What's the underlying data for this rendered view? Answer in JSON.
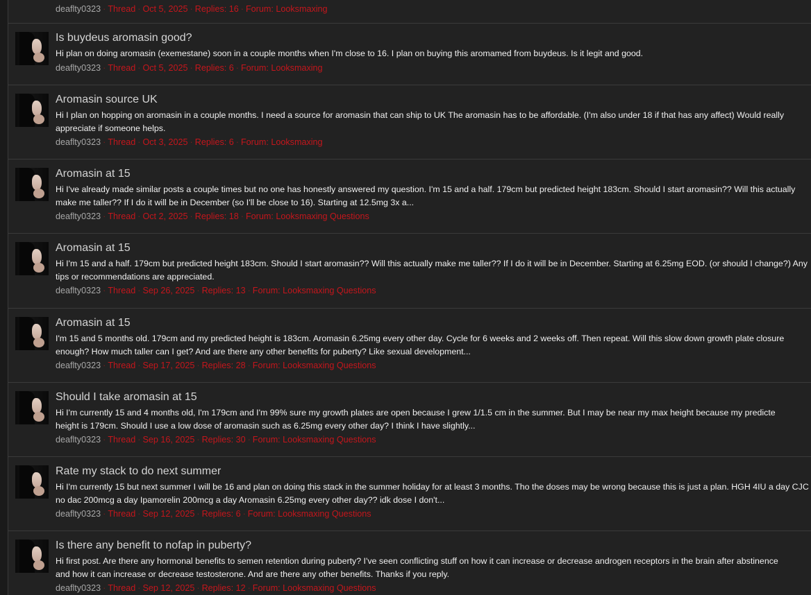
{
  "colors": {
    "background": "#222222",
    "accent_red": "#c4161c",
    "title": "#d4d4d4",
    "author": "#a8a8a8",
    "divider": "#3b3b3b"
  },
  "results": [
    {
      "title": "",
      "snippet": "",
      "author": "deaflty0323",
      "type": "Thread",
      "date": "Oct 5, 2025",
      "replies": "Replies: 16",
      "forum": "Forum: Looksmaxing"
    },
    {
      "title": "Is buydeus aromasin good?",
      "snippet": "Hi plan on doing aromasin (exemestane) soon in a couple months when I'm close to 16. I plan on buying this aromamed from buydeus. Is it legit and good.",
      "author": "deaflty0323",
      "type": "Thread",
      "date": "Oct 5, 2025",
      "replies": "Replies: 6",
      "forum": "Forum: Looksmaxing"
    },
    {
      "title": "Aromasin source UK",
      "snippet": "Hi I plan on hopping on aromasin in a couple months. I need a source for aromasin that can ship to UK The aromasin has to be affordable. (I'm also under 18 if that has any affect) Would really appreciate if someone helps.",
      "author": "deaflty0323",
      "type": "Thread",
      "date": "Oct 3, 2025",
      "replies": "Replies: 6",
      "forum": "Forum: Looksmaxing"
    },
    {
      "title": "Aromasin at 15",
      "snippet": "Hi I've already made similar posts a couple times but no one has honestly answered my question. I'm 15 and a half. 179cm but predicted height 183cm. Should I start aromasin?? Will this actually make me taller?? If I do it will be in December (so I'll be close to 16). Starting at 12.5mg 3x a...",
      "author": "deaflty0323",
      "type": "Thread",
      "date": "Oct 2, 2025",
      "replies": "Replies: 18",
      "forum": "Forum: Looksmaxing Questions"
    },
    {
      "title": "Aromasin at 15",
      "snippet": "Hi I'm 15 and a half. 179cm but predicted height 183cm. Should I start aromasin?? Will this actually make me taller?? If I do it will be in December. Starting at 6.25mg EOD. (or should I change?) Any tips or recommendations are appreciated.",
      "author": "deaflty0323",
      "type": "Thread",
      "date": "Sep 26, 2025",
      "replies": "Replies: 13",
      "forum": "Forum: Looksmaxing Questions"
    },
    {
      "title": "Aromasin at 15",
      "snippet": "I'm 15 and 5 months old. 179cm and my predicted height is 183cm. Aromasin 6.25mg every other day. Cycle for 6 weeks and 2 weeks off. Then repeat. Will this slow down growth plate closure enough? How much taller can I get? And are there any other benefits for puberty? Like sexual development...",
      "author": "deaflty0323",
      "type": "Thread",
      "date": "Sep 17, 2025",
      "replies": "Replies: 28",
      "forum": "Forum: Looksmaxing Questions"
    },
    {
      "title": "Should I take aromasin at 15",
      "snippet_line1": "Hi I'm currently 15 and 4 months old, I'm 179cm and I'm 99% sure my growth plates are open because I grew 1/1.5 cm in the summer. But I may be near my max height because my predicte",
      "snippet_line2": "height is 179cm. Should I use a low dose of aromasin such as 6.25mg every other day? I think I have slightly...",
      "author": "deaflty0323",
      "type": "Thread",
      "date": "Sep 16, 2025",
      "replies": "Replies: 30",
      "forum": "Forum: Looksmaxing Questions"
    },
    {
      "title": "Rate my stack to do next summer",
      "snippet": "Hi I'm currently 15 but next summer I will be 16 and plan on doing this stack in the summer holiday for at least 3 months. Tho the doses may be wrong because this is just a plan. HGH 4IU a day CJC no dac 200mcg a day Ipamorelin 200mcg a day Aromasin 6.25mg every other day?? idk dose I don't...",
      "author": "deaflty0323",
      "type": "Thread",
      "date": "Sep 12, 2025",
      "replies": "Replies: 6",
      "forum": "Forum: Looksmaxing Questions"
    },
    {
      "title": "Is there any benefit to nofap in puberty?",
      "snippet_line1": "Hi first post. Are there any hormonal benefits to semen retention during puberty? I've seen conflicting stuff on how it can increase or decrease androgen receptors in the brain after abstinence",
      "snippet_line2": "and how it can increase or decrease testosterone. And are there any other benefits. Thanks if you reply.",
      "author": "deaflty0323",
      "type": "Thread",
      "date": "Sep 12, 2025",
      "replies": "Replies: 12",
      "forum": "Forum: Looksmaxing Questions"
    }
  ]
}
